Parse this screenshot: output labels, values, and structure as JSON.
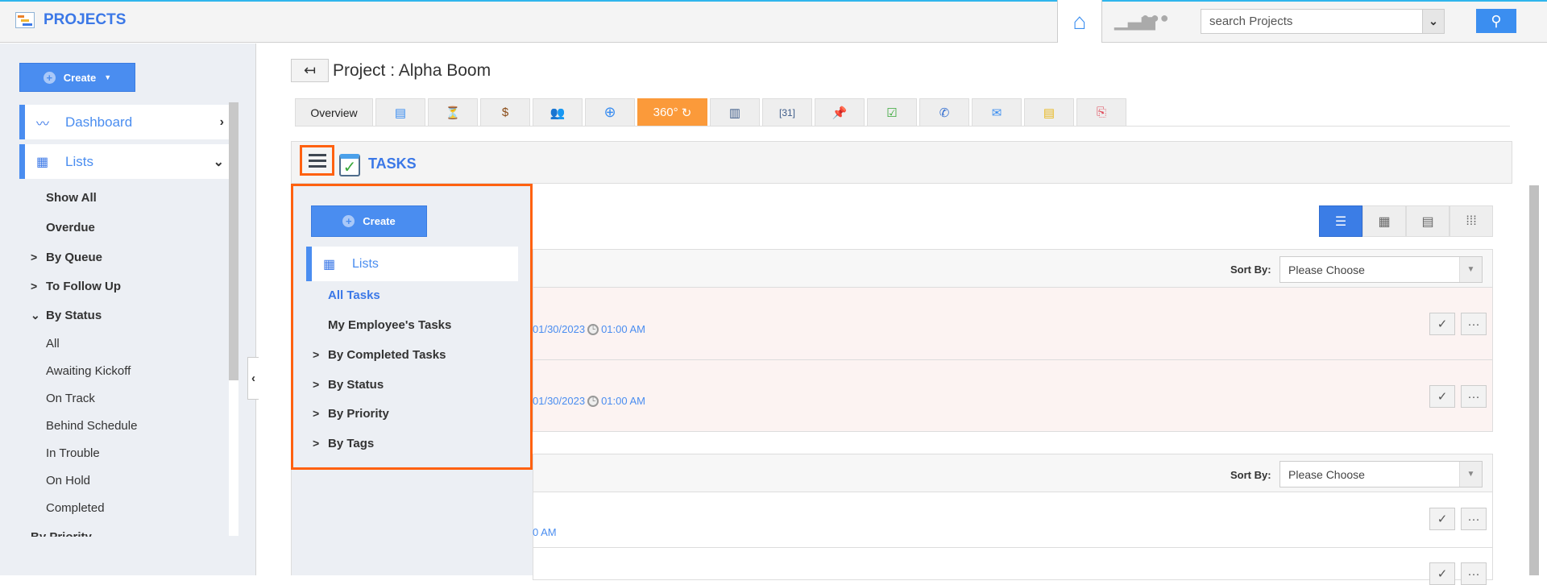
{
  "header": {
    "app_title": "PROJECTS",
    "search_placeholder": "search Projects",
    "icons": [
      "projects-logo-icon",
      "home-icon",
      "chart-icon",
      "more-icon",
      "chevron-down-icon",
      "search-icon"
    ],
    "accent": "#3b78e7"
  },
  "sidebar": {
    "create_label": "Create",
    "nav": [
      {
        "label": "Dashboard",
        "icon": "chart-line-icon"
      },
      {
        "label": "Lists",
        "icon": "grid-icon"
      }
    ],
    "lists": [
      "Show All",
      "Overdue"
    ],
    "collapsible": [
      "By Queue",
      "To Follow Up"
    ],
    "by_status": {
      "label": "By Status",
      "items": [
        "All",
        "Awaiting Kickoff",
        "On Track",
        "Behind Schedule",
        "In Trouble",
        "On Hold",
        "Completed"
      ]
    },
    "cut_off": "By Priority"
  },
  "main": {
    "title": "Project : Alpha Boom",
    "tabs": [
      {
        "label": "Overview"
      },
      {
        "icon": "gantt-icon"
      },
      {
        "icon": "milestone-icon"
      },
      {
        "icon": "money-bag-icon"
      },
      {
        "icon": "team-icon"
      },
      {
        "icon": "target-icon"
      },
      {
        "label": "360°",
        "icon": "refresh-icon",
        "active": true
      },
      {
        "icon": "form-icon"
      },
      {
        "icon": "calendar-icon"
      },
      {
        "icon": "pin-icon"
      },
      {
        "icon": "tasks-icon"
      },
      {
        "icon": "phone-icon"
      },
      {
        "icon": "mail-icon"
      },
      {
        "icon": "notes-icon"
      },
      {
        "icon": "attachment-icon"
      }
    ],
    "section_title": "TASKS",
    "sort_label": "Sort By:",
    "sort_value": "Please Choose",
    "groups": [
      {
        "rows": [
          {
            "date": "01/30/2023",
            "time": "01:00 AM"
          },
          {
            "date": "01/30/2023",
            "time": "01:00 AM"
          }
        ]
      },
      {
        "rows": [
          {
            "time_partial": "0 AM"
          }
        ]
      }
    ],
    "overdue_row_color": "#fcf3f2"
  },
  "dropdown": {
    "create_label": "Create",
    "lists_label": "Lists",
    "items": [
      "All Tasks",
      "My Employee's Tasks"
    ],
    "collapsible": [
      "By Completed Tasks",
      "By Status",
      "By Priority",
      "By Tags"
    ],
    "highlight_color": "#ff6110"
  }
}
